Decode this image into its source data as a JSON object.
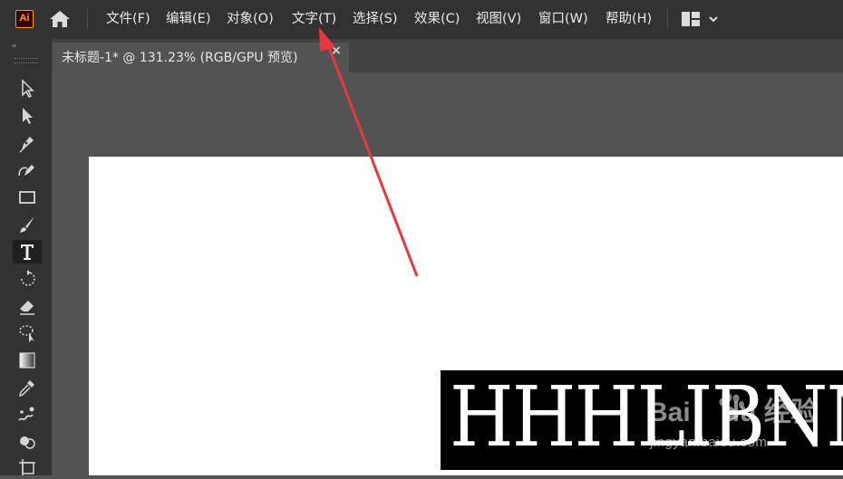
{
  "app": {
    "logo_text": "Ai"
  },
  "menu": [
    {
      "label": "文件(F)"
    },
    {
      "label": "编辑(E)"
    },
    {
      "label": "对象(O)"
    },
    {
      "label": "文字(T)"
    },
    {
      "label": "选择(S)"
    },
    {
      "label": "效果(C)"
    },
    {
      "label": "视图(V)"
    },
    {
      "label": "窗口(W)"
    },
    {
      "label": "帮助(H)"
    }
  ],
  "document_tab": {
    "title": "未标题-1* @ 131.23% (RGB/GPU 预览)",
    "close_glyph": "×"
  },
  "toolbar": {
    "collapse_glyph": "››",
    "tools": [
      {
        "icon": "selection-tool-icon"
      },
      {
        "icon": "direct-selection-tool-icon"
      },
      {
        "icon": "pen-tool-icon"
      },
      {
        "icon": "curvature-tool-icon"
      },
      {
        "icon": "rectangle-tool-icon"
      },
      {
        "icon": "paintbrush-tool-icon"
      },
      {
        "icon": "type-tool-icon",
        "active": true
      },
      {
        "icon": "rotate-tool-icon"
      },
      {
        "icon": "eraser-tool-icon"
      },
      {
        "icon": "lasso-tool-icon"
      },
      {
        "icon": "gradient-tool-icon"
      },
      {
        "icon": "eyedropper-tool-icon"
      },
      {
        "icon": "puppet-warp-tool-icon"
      },
      {
        "icon": "shape-builder-tool-icon"
      },
      {
        "icon": "artboard-tool-icon"
      }
    ]
  },
  "artboard": {
    "text": "HHHLIBNN"
  },
  "watermark": {
    "logo_latin": "Bai",
    "logo_suffix": "du",
    "logo_cn": "经验",
    "url": "jingyan.baidu.com"
  },
  "colors": {
    "accent": "#ff9a00",
    "menubar": "#323232",
    "workspace": "#535353",
    "arrow": "#e8383d"
  }
}
